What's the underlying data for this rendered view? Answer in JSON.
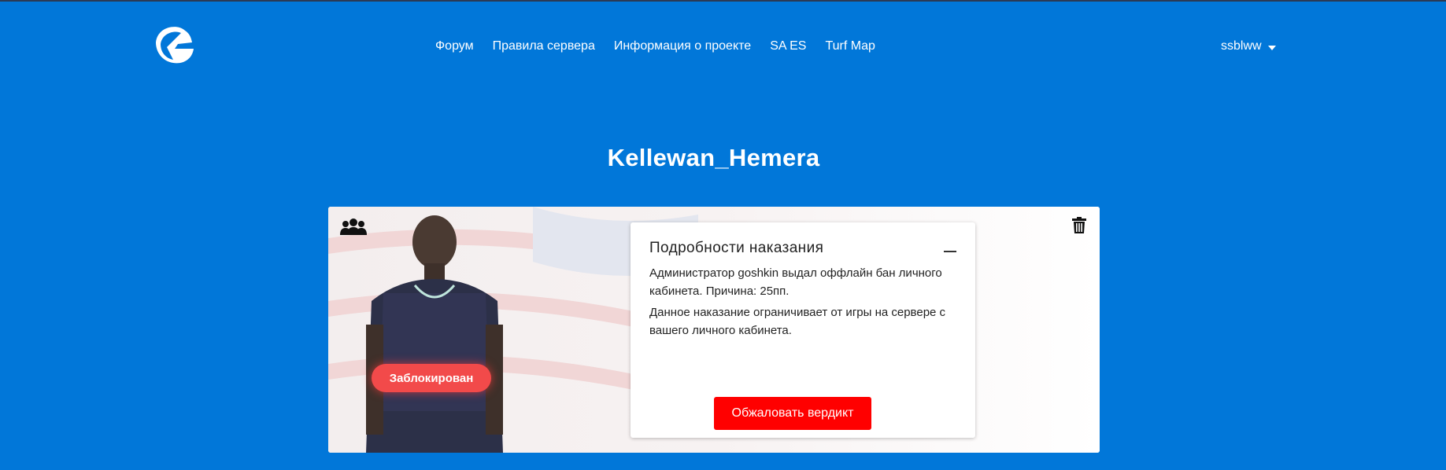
{
  "header": {
    "logo_icon": "stylized-G-logo-icon",
    "nav": [
      "Форум",
      "Правила сервера",
      "Информация о проекте",
      "SA ES",
      "Turf Map"
    ],
    "user": {
      "name": "ssblww",
      "dropdown_icon": "caret-down-icon"
    }
  },
  "profile": {
    "name": "Kellewan_Hemera",
    "status_badge": "Заблокирован",
    "icons": {
      "group": "users-group-icon",
      "delete": "trash-icon"
    }
  },
  "punishment": {
    "title": "Подробности наказания",
    "detail": "Администратор goshkin выдал оффлайн бан личного кабинета. Причина: 25пп.",
    "note": "Данное наказание ограничивает от игры на сервере с вашего личного кабинета.",
    "appeal_button": "Обжаловать вердикт"
  },
  "colors": {
    "background": "#0177d9",
    "appeal_button": "#ff0000",
    "badge": "#f24a4a"
  }
}
